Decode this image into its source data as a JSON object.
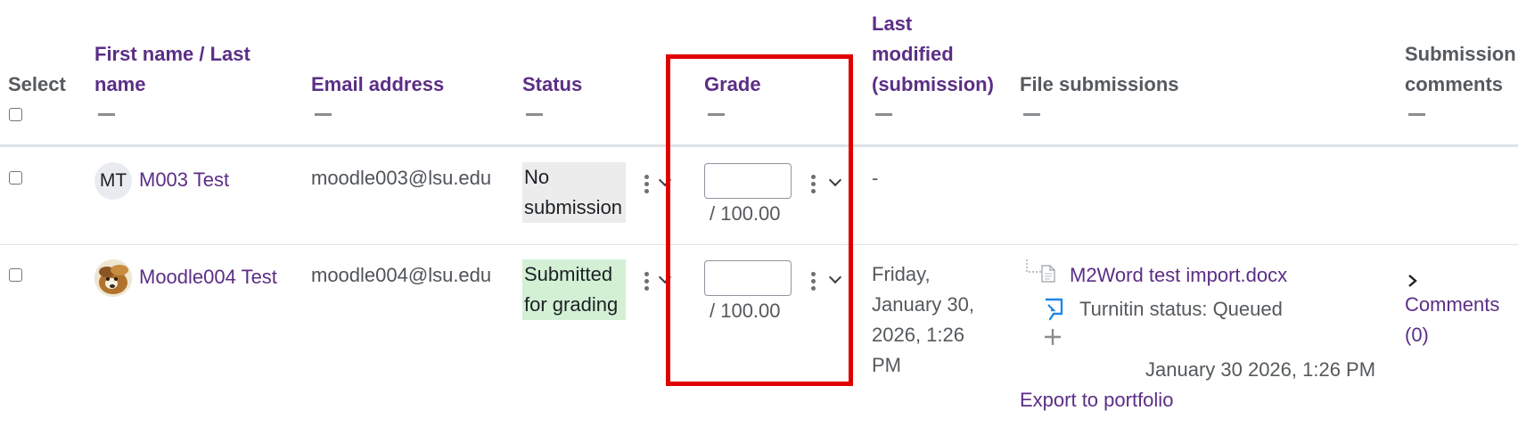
{
  "table": {
    "headers": {
      "select": "Select",
      "name_line1": "First name / Last",
      "name_line2": "name",
      "email": "Email address",
      "status": "Status",
      "grade": "Grade",
      "last_modified_line1": "Last",
      "last_modified_line2": "modified",
      "last_modified_line3": "(submission)",
      "file_submissions": "File submissions",
      "submission_comments_line1": "Submission",
      "submission_comments_line2": "comments"
    },
    "rows": [
      {
        "avatar_initials": "MT",
        "name": "M003 Test",
        "email": "moodle003@lsu.edu",
        "status_line1": "No",
        "status_line2": "submission",
        "grade_value": "",
        "grade_out_of": "/ 100.00",
        "last_modified": "-"
      },
      {
        "name": "Moodle004 Test",
        "email": "moodle004@lsu.edu",
        "status_line1": "Submitted",
        "status_line2": "for grading",
        "grade_value": "",
        "grade_out_of": "/ 100.00",
        "last_modified_line1": "Friday,",
        "last_modified_line2": "January 30,",
        "last_modified_line3": "2026, 1:26",
        "last_modified_line4": "PM",
        "file_name": "M2Word test import.docx",
        "turnitin_status": "Turnitin status: Queued",
        "file_timestamp": "January 30 2026, 1:26 PM",
        "export_link": "Export to portfolio",
        "comments_line1": "Comments",
        "comments_line2": "(0)"
      }
    ]
  },
  "colors": {
    "header_link": "#5b2e86",
    "highlight_border": "#e00000",
    "status_no_submission_bg": "#ececec",
    "status_submitted_bg": "#d3f0d5"
  },
  "icons": {
    "file": "file-icon",
    "turnitin": "turnitin-icon",
    "plus": "plus-icon",
    "kebab": "kebab-menu-icon",
    "chevron": "chevron-down-icon",
    "chevron_right": "chevron-right-icon"
  }
}
